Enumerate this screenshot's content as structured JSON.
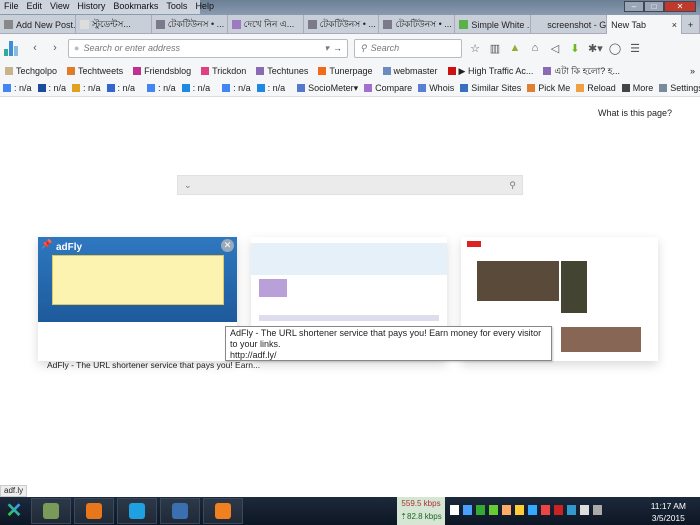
{
  "menu": [
    "File",
    "Edit",
    "View",
    "History",
    "Bookmarks",
    "Tools",
    "Help"
  ],
  "tabs": [
    {
      "label": "Add New Post...",
      "color": "#888"
    },
    {
      "label": "স্টুডেন্টস...",
      "color": "#ddd"
    },
    {
      "label": "টেকটিউনস • ...",
      "color": "#7a7a8a"
    },
    {
      "label": "দেখে নিন এ...",
      "color": "#9b7ac0"
    },
    {
      "label": "টেকটিউনস • ...",
      "color": "#7a7a8a"
    },
    {
      "label": "টেকটিউনস • ...",
      "color": "#7a7a8a"
    },
    {
      "label": "Simple White ...",
      "color": "#5ab04a"
    },
    {
      "label": "screenshot - Go...",
      "color": "#c9cfd8"
    }
  ],
  "active_tab": {
    "label": "New Tab",
    "close": "×"
  },
  "new_tab_button": "+",
  "nav": {
    "url_placeholder": "Search or enter address",
    "search_placeholder": "Search"
  },
  "bookmarks": [
    {
      "label": "Techgolpo",
      "color": "#c9b48a"
    },
    {
      "label": "Techtweets",
      "color": "#e07b2a"
    },
    {
      "label": "Friendsblog",
      "color": "#c03090"
    },
    {
      "label": "Trickdon",
      "color": "#e04080"
    },
    {
      "label": "Techtunes",
      "color": "#8a6ab0"
    },
    {
      "label": "Tunerpage",
      "color": "#f06a1a"
    },
    {
      "label": "webmaster",
      "color": "#6a8ac0"
    },
    {
      "label": "▶ High Traffic Ac...",
      "color": "#d01010"
    },
    {
      "label": "এটা কি হলো? হ...",
      "color": "#8a6ab0"
    }
  ],
  "bookmarks_overflow": "»",
  "addons": [
    {
      "label": ": n/a",
      "color": "#4285f4"
    },
    {
      "label": ": n/a",
      "color": "#1a4c9a"
    },
    {
      "label": ": n/a",
      "color": "#e0a020"
    },
    {
      "label": ": n/a",
      "color": "#3366cc"
    },
    {
      "label": ": n/a",
      "color": "#4285f4"
    },
    {
      "label": ": n/a",
      "color": "#1e88e5"
    },
    {
      "label": ": n/a",
      "color": "#4285f4"
    },
    {
      "label": ": n/a",
      "color": "#1e88e5"
    },
    {
      "label": "SocioMeter▾",
      "color": "#5577cc"
    },
    {
      "label": "Compare",
      "color": "#a070d0"
    },
    {
      "label": "Whois",
      "color": "#5a7fd0"
    },
    {
      "label": "Similar Sites",
      "color": "#3a70c0"
    },
    {
      "label": "Pick Me",
      "color": "#e08030"
    },
    {
      "label": "Reload",
      "color": "#f0a040"
    },
    {
      "label": "More",
      "color": "#444"
    },
    {
      "label": "Settings",
      "color": "#7a8a9a"
    }
  ],
  "what_is_this_page": "What is this page?",
  "tiles": [
    {
      "title": "AdFly - The URL shortener service that pays you! Earn...",
      "logo": "adFly"
    }
  ],
  "tooltip": {
    "line1": "AdFly - The URL shortener service that pays you! Earn money for every visitor to your links.",
    "line2": "http://adf.ly/"
  },
  "status": "adf.ly",
  "taskbar": {
    "apps": [
      "#7a9a5a",
      "#e8761a",
      "#1fa0e0",
      "#3a70b0",
      "#f08020"
    ],
    "net_down": "559.5 kbps",
    "net_up": "⇡82.8 kbps",
    "time": "11:17 AM",
    "date": "3/5/2015"
  },
  "tray_colors": [
    "#fff",
    "#4aa0ff",
    "#3a3",
    "#6c3",
    "#fa6",
    "#fc3",
    "#3af",
    "#e44",
    "#c22",
    "#39c",
    "#ddd",
    "#aaa"
  ]
}
